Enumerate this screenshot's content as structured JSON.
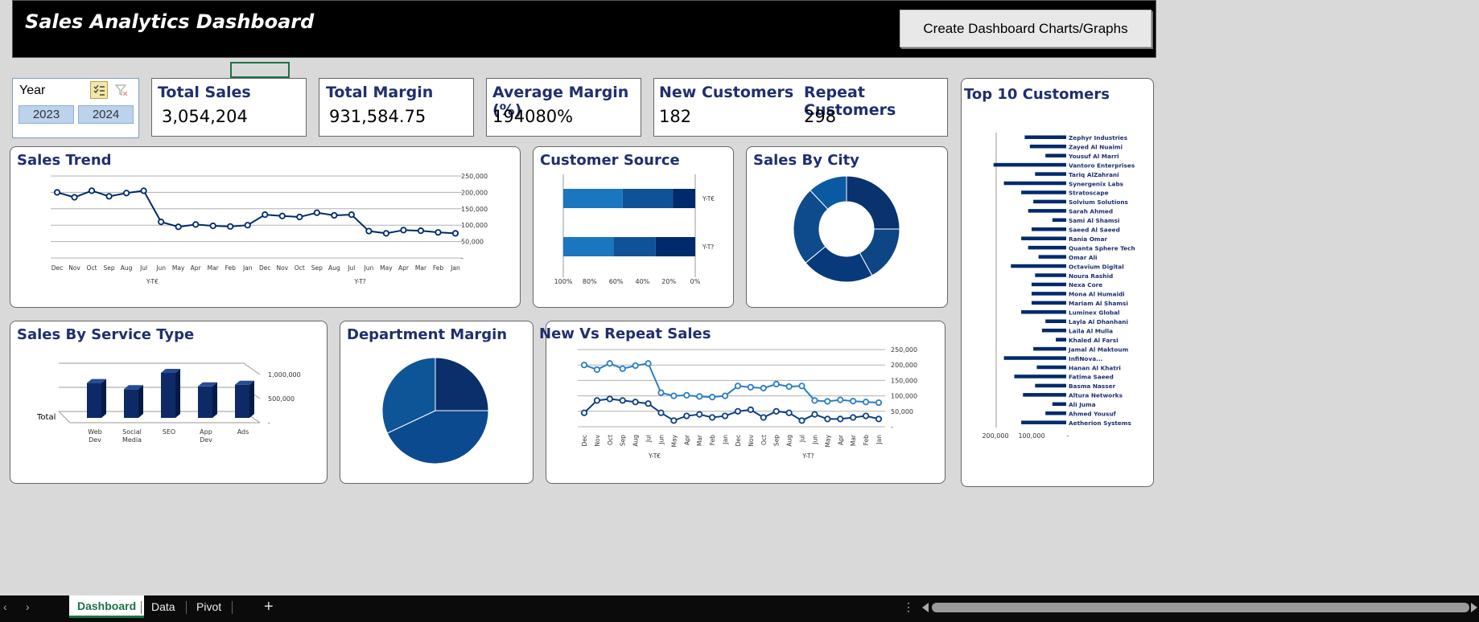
{
  "header": {
    "title": "Sales Analytics Dashboard",
    "button_label": "Create Dashboard Charts/Graphs"
  },
  "slicer": {
    "title": "Year",
    "options": [
      "2023",
      "2024"
    ]
  },
  "kpis": {
    "total_sales": {
      "label": "Total Sales",
      "value": "3,054,204"
    },
    "total_margin": {
      "label": "Total Margin",
      "value": "931,584.75"
    },
    "avg_margin": {
      "label": "Average Margin (%)",
      "value": "194080%"
    },
    "new_customers": {
      "label": "New Customers",
      "value": "182"
    },
    "repeat_customers": {
      "label": "Repeat Customers",
      "value": "298"
    }
  },
  "colors": {
    "navy": "#002a6c",
    "mid": "#0f5298",
    "light": "#1b76c0",
    "title": "#1f2f6e"
  },
  "sheet_tabs": [
    "Dashboard",
    "Data",
    "Pivot"
  ],
  "chart_data": [
    {
      "id": "sales_trend",
      "type": "line",
      "title": "Sales Trend",
      "categories": [
        "Dec",
        "Nov",
        "Oct",
        "Sep",
        "Aug",
        "Jul",
        "Jun",
        "May",
        "Apr",
        "Mar",
        "Feb",
        "Jan",
        "Dec",
        "Nov",
        "Oct",
        "Sep",
        "Aug",
        "Jul",
        "Jun",
        "May",
        "Apr",
        "Mar",
        "Feb",
        "Jan"
      ],
      "groups": [
        "Y-T€",
        "Y-T?"
      ],
      "values": [
        200000,
        185000,
        205000,
        188000,
        198000,
        205000,
        110000,
        95000,
        102000,
        98000,
        96000,
        100000,
        132000,
        128000,
        125000,
        138000,
        130000,
        132000,
        82000,
        75000,
        85000,
        83000,
        78000,
        75000
      ],
      "yticks": [
        "250,000",
        "200,000",
        "150,000",
        "100,000",
        "50,000",
        "-"
      ],
      "ylim": [
        0,
        250000
      ]
    },
    {
      "id": "customer_source",
      "type": "bar",
      "title": "Customer Source",
      "categories": [
        "Y-T€",
        "Y-T?"
      ],
      "series": [
        {
          "values": [
            45,
            38
          ]
        },
        {
          "values": [
            38,
            32
          ]
        },
        {
          "values": [
            17,
            30
          ]
        }
      ],
      "xticks": [
        "100%",
        "80%",
        "60%",
        "40%",
        "20%",
        "0%"
      ]
    },
    {
      "id": "sales_by_city",
      "type": "pie",
      "title": "Sales By City",
      "values": [
        25,
        17,
        22,
        24,
        12
      ]
    },
    {
      "id": "sales_by_service",
      "type": "bar",
      "title": "Sales By Service Type",
      "categories": [
        "Web Dev",
        "Social Media",
        "SEO",
        "App Dev",
        "Ads"
      ],
      "values": [
        620000,
        510000,
        800000,
        560000,
        590000
      ],
      "yticks": [
        "1,000,000",
        "500,000",
        "-"
      ],
      "series_label": "Total"
    },
    {
      "id": "department_margin",
      "type": "pie",
      "title": "Department Margin",
      "values": [
        25,
        43,
        32
      ]
    },
    {
      "id": "new_vs_repeat",
      "type": "line",
      "title": "New Vs Repeat Sales",
      "categories": [
        "Dec",
        "Nov",
        "Oct",
        "Sep",
        "Aug",
        "Jul",
        "Jun",
        "May",
        "Apr",
        "Mar",
        "Feb",
        "Jan",
        "Dec",
        "Nov",
        "Oct",
        "Sep",
        "Aug",
        "Jul",
        "Jun",
        "May",
        "Apr",
        "Mar",
        "Feb",
        "Jan"
      ],
      "groups": [
        "Y-T€",
        "Y-T?"
      ],
      "series": [
        {
          "values": [
            200000,
            185000,
            205000,
            188000,
            198000,
            205000,
            110000,
            100000,
            102000,
            98000,
            96000,
            100000,
            132000,
            128000,
            125000,
            138000,
            130000,
            132000,
            85000,
            82000,
            87000,
            83000,
            80000,
            78000
          ]
        },
        {
          "values": [
            45000,
            85000,
            90000,
            85000,
            80000,
            75000,
            45000,
            20000,
            35000,
            40000,
            30000,
            35000,
            50000,
            55000,
            30000,
            50000,
            45000,
            20000,
            40000,
            25000,
            25000,
            30000,
            35000,
            25000
          ]
        }
      ],
      "yticks": [
        "250,000",
        "200,000",
        "150,000",
        "100,000",
        "50,000",
        "-"
      ],
      "ylim": [
        0,
        250000
      ]
    },
    {
      "id": "top10_customers",
      "type": "bar",
      "title": "Top 10 Customers",
      "categories": [
        "Zephyr Industries",
        "Zayed Al Nuaimi",
        "Yousuf Al Marri",
        "Vantoro Enterprises",
        "Tariq AlZahrani",
        "Synergenix Labs",
        "Stratoscape",
        "Solvium Solutions",
        "Sarah Ahmed",
        "Sami Al Shamsi",
        "Saeed Al Saeed",
        "Rania Omar",
        "Quanta Sphere Tech",
        "Omar Ali",
        "Octavium Digital",
        "Noura Rashid",
        "Nexa Core",
        "Mona Al Humaidi",
        "Mariam Al Shamsi",
        "Luminex Global",
        "Layla Al Dhanhani",
        "Laila Al Mulla",
        "Khaled Al Farsi",
        "Jamal Al Maktoum",
        "InfiNova...",
        "Hanan Al Khatri",
        "Fatima Saeed",
        "Basma Nasser",
        "Altura Networks",
        "Ali Juma",
        "Ahmed Yousuf",
        "Aetherion Systems"
      ],
      "values": [
        120000,
        105000,
        60000,
        210000,
        90000,
        180000,
        130000,
        95000,
        110000,
        40000,
        100000,
        130000,
        110000,
        80000,
        160000,
        90000,
        100000,
        100000,
        100000,
        130000,
        60000,
        70000,
        30000,
        95000,
        180000,
        85000,
        150000,
        90000,
        125000,
        40000,
        60000,
        130000
      ],
      "xticks": [
        "200,000",
        "100,000",
        "-"
      ]
    }
  ]
}
